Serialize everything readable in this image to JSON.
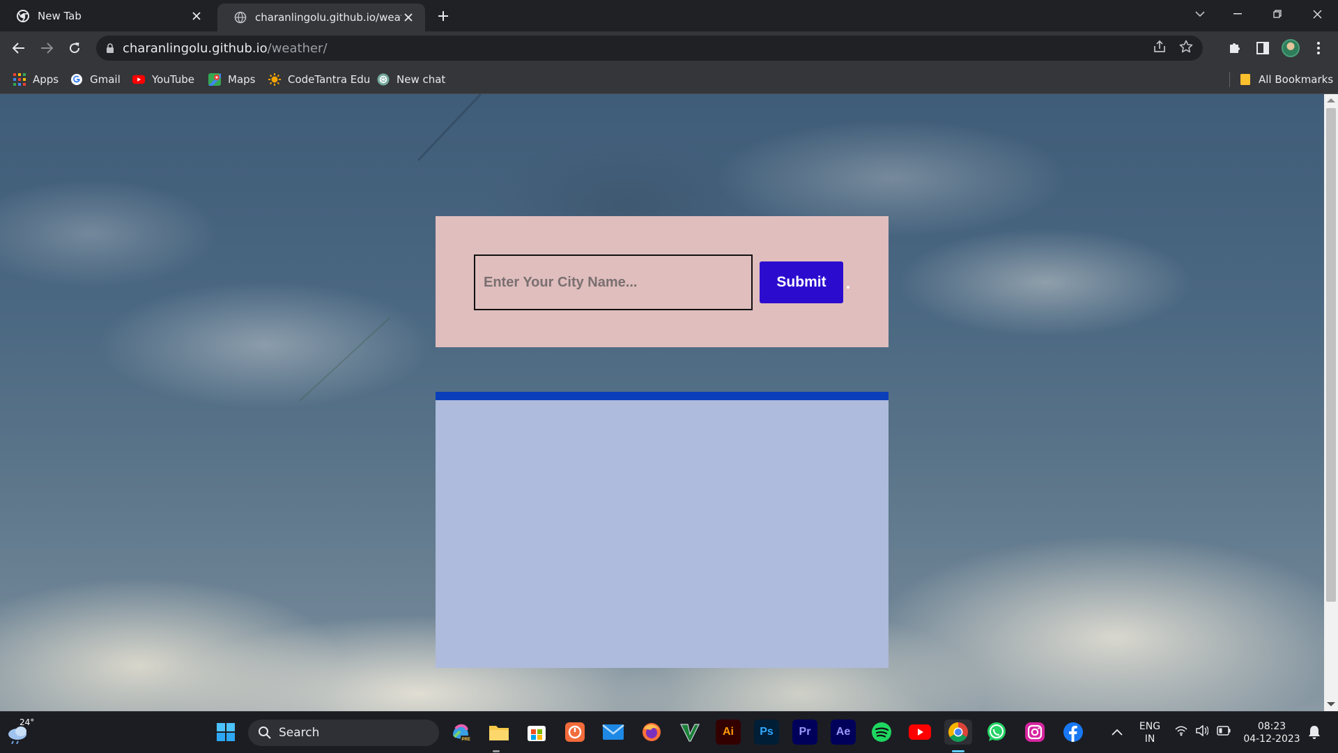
{
  "browser": {
    "tabs": [
      {
        "title": "New Tab",
        "active": false
      },
      {
        "title": "charanlingolu.github.io/weather/",
        "active": true
      }
    ],
    "url": {
      "host": "charanlingolu.github.io",
      "path": "/weather/"
    },
    "bookmarks": [
      "Apps",
      "Gmail",
      "YouTube",
      "Maps",
      "CodeTantra Edu",
      "New chat"
    ],
    "all_bookmarks": "All Bookmarks"
  },
  "page": {
    "city_input_placeholder": "Enter Your City Name...",
    "city_input_value": "",
    "submit_label": "Submit",
    "colors": {
      "form_card": "#e0bebe",
      "submit_button": "#2b0ccf",
      "result_card": "#aebbdc",
      "result_card_border": "#0b3fba"
    }
  },
  "taskbar": {
    "weather_temp": "24°",
    "search_label": "Search",
    "apps": [
      "copilot",
      "file-explorer",
      "microsoft-store",
      "app-orange",
      "mail",
      "firefox",
      "vim",
      "illustrator",
      "photoshop",
      "premiere-pro",
      "after-effects",
      "spotify",
      "youtube",
      "chrome",
      "whatsapp",
      "instagram",
      "facebook"
    ],
    "language": {
      "line1": "ENG",
      "line2": "IN"
    },
    "time": "08:23",
    "date": "04-12-2023"
  }
}
